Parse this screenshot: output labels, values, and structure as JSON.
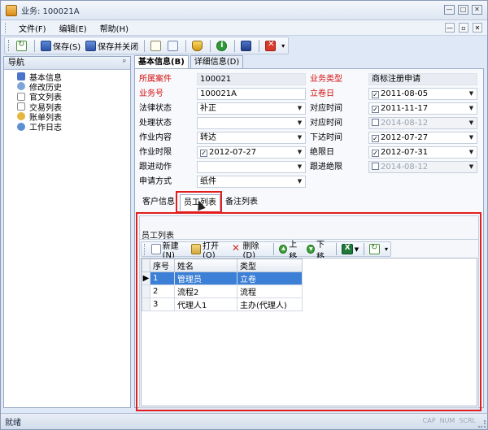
{
  "window": {
    "title": "业务: 100021A"
  },
  "menu": {
    "items": [
      "文件(F)",
      "编辑(E)",
      "帮助(H)"
    ]
  },
  "toolbar": {
    "save": "保存(S)",
    "save_close": "保存并关闭"
  },
  "nav": {
    "title": "导航",
    "items": [
      "基本信息",
      "修改历史",
      "官文列表",
      "交易列表",
      "账单列表",
      "工作日志"
    ]
  },
  "main_tabs": [
    "基本信息(B)",
    "详细信息(D)"
  ],
  "form": {
    "case_label": "所属案件",
    "case_value": "100021",
    "business_type_label": "业务类型",
    "business_type_value": "商标注册申请",
    "business_no_label": "业务号",
    "business_no_value": "100021A",
    "filing_date_label": "立卷日",
    "filing_date_value": "2011-08-05",
    "legal_status_label": "法律状态",
    "legal_status_value": "补正",
    "response_time_label": "对应时间",
    "response_time_value": "2011-11-17",
    "handling_status_label": "处理状态",
    "handling_status_value": "",
    "response_time2_label": "对应时间",
    "response_time2_value": "2014-08-12",
    "operation_label": "作业内容",
    "operation_value": "转达",
    "issue_time_label": "下达时间",
    "issue_time_value": "2012-07-27",
    "op_deadline_label": "作业时限",
    "op_deadline_value": "2012-07-27",
    "final_deadline_label": "绝限日",
    "final_deadline_value": "2012-07-31",
    "follow_label": "跟进动作",
    "follow_value": "",
    "follow_final_label": "跟进绝限",
    "follow_final_value": "2014-08-12",
    "apply_method_label": "申请方式",
    "apply_method_value": "纸件"
  },
  "sub_tabs": [
    "客户信息",
    "员工列表",
    "备注列表"
  ],
  "panel": {
    "title": "员工列表"
  },
  "subtoolbar": {
    "new": "新建(N)",
    "open": "打开(O)",
    "delete": "删除(D)",
    "up": "上移",
    "down": "下移"
  },
  "grid": {
    "columns": [
      "序号",
      "姓名",
      "类型"
    ],
    "rows": [
      {
        "no": "1",
        "name": "管理员",
        "type": "立卷"
      },
      {
        "no": "2",
        "name": "流程2",
        "type": "流程"
      },
      {
        "no": "3",
        "name": "代理人1",
        "type": "主办(代理人)"
      }
    ]
  },
  "status": {
    "text": "就绪",
    "indicators": [
      "CAP",
      "NUM",
      "SCRL"
    ]
  },
  "colors": {
    "highlight": "#e21d1d",
    "selection": "#3b7fd6",
    "required_label": "#d40f0f"
  }
}
